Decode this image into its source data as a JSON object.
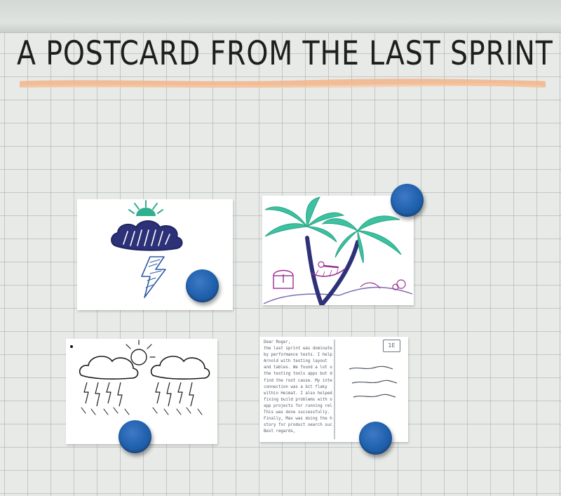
{
  "board": {
    "title": "A POSTCARD FROM THE LAST SPRINT",
    "underline_color": "#f2b48a"
  },
  "cards": {
    "storm_cloud": {
      "pictured": "storm cloud with sun and lightning bolt"
    },
    "palm_beach": {
      "pictured": "two palm trees with hammock and treasure chest"
    },
    "thunderstorm": {
      "pictured": "two thunder clouds with sun and lightning rain"
    },
    "letter_card": {
      "stamp": "1E",
      "letter_lines": [
        "Dear Roger,",
        "the last sprint was dominated",
        "by performance tests. I helped",
        "Arnold with testing layout",
        "and tables. We found a lot of",
        "the testing tools apps but didnt",
        "find the root cause. My internet",
        "connection was a bit flaky",
        "within Heimat. I also helped",
        "fixing build problems with older",
        "app projects for running releases.",
        "This was done successfully.",
        "Finally, Max was doing the hard",
        "story for product search successfully.",
        "Best regards,"
      ]
    }
  },
  "colors": {
    "magnet": "#2263b0",
    "board": "#e8eae7",
    "sketch_navy": "#2d3278",
    "sketch_teal": "#2fb08e",
    "sketch_purple": "#9a2f8e"
  }
}
